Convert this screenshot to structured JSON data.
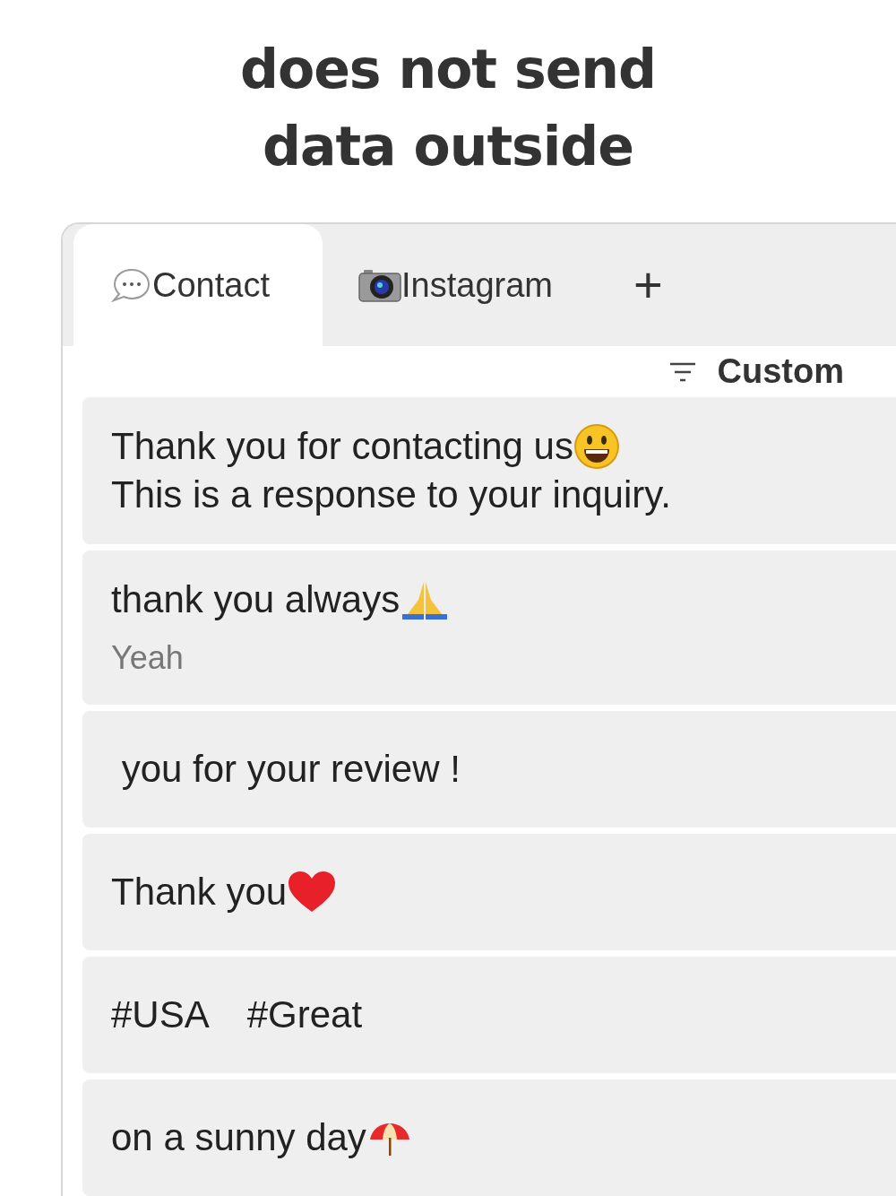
{
  "headline": [
    "does not send",
    "data outside"
  ],
  "tabs": [
    {
      "label": "Contact",
      "selected": true
    },
    {
      "label": "Instagram",
      "selected": false
    }
  ],
  "add_tab": "+",
  "sort": {
    "label": "Custom"
  },
  "phrases": [
    {
      "text": "Thank you for contacting us",
      "second_line": "This is a response to your inquiry."
    },
    {
      "text": "thank you always",
      "note": "Yeah"
    },
    {
      "text": " you for your review !"
    },
    {
      "text": "Thank you"
    },
    {
      "text": "#USA #Great"
    },
    {
      "text": "on a sunny day"
    }
  ]
}
